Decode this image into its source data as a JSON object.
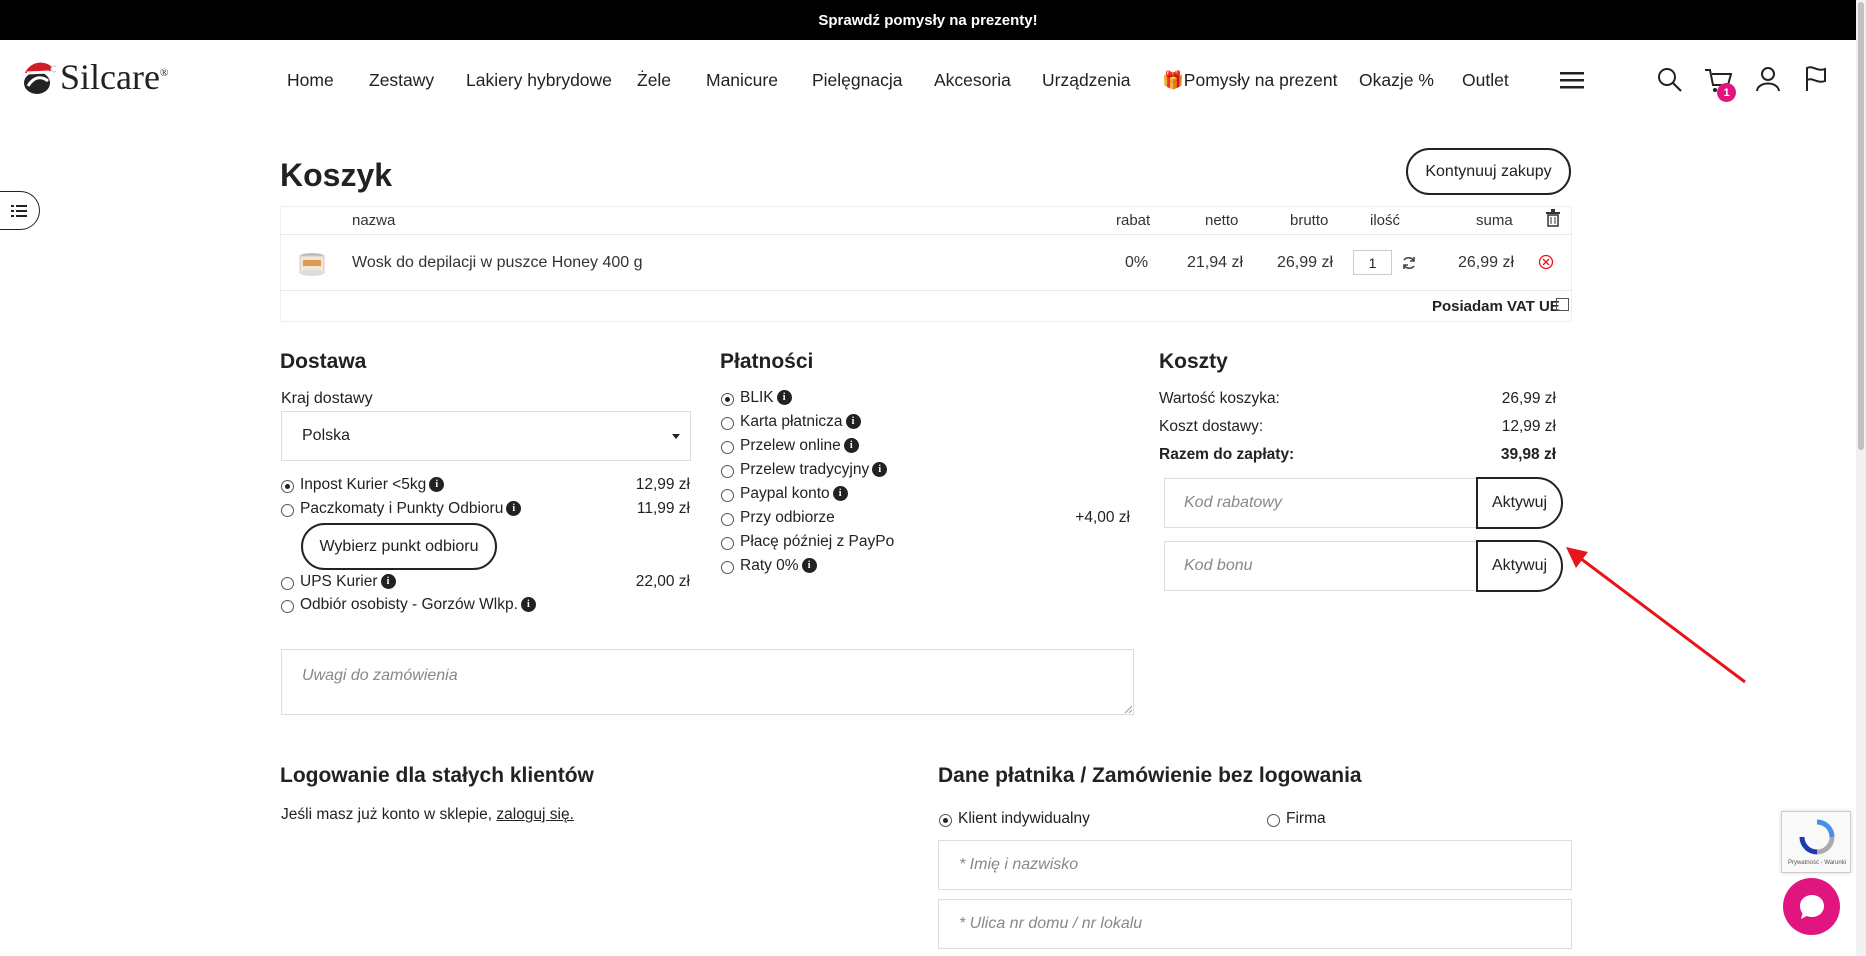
{
  "promo_bar": "Sprawdź pomysły na prezenty!",
  "logo": {
    "text": "Silcare",
    "reg": "®"
  },
  "nav": [
    "Home",
    "Zestawy",
    "Lakiery hybrydowe",
    "Żele",
    "Manicure",
    "Pielęgnacja",
    "Akcesoria",
    "Urządzenia",
    "Pomysły na prezent",
    "Okazje %",
    "Outlet"
  ],
  "cart_count": "1",
  "page_title": "Koszyk",
  "continue_label": "Kontynuuj zakupy",
  "cart": {
    "headers": {
      "name": "nazwa",
      "discount": "rabat",
      "net": "netto",
      "gross": "brutto",
      "qty": "ilość",
      "sum": "suma"
    },
    "items": [
      {
        "name": "Wosk do depilacji w puszce Honey 400 g",
        "discount": "0%",
        "net": "21,94 zł",
        "gross": "26,99 zł",
        "qty": "1",
        "sum": "26,99 zł"
      }
    ],
    "vat_label": "Posiadam VAT UE"
  },
  "delivery": {
    "title": "Dostawa",
    "country_label": "Kraj dostawy",
    "country": "Polska",
    "options": [
      {
        "label": "Inpost Kurier <5kg",
        "price": "12,99 zł",
        "selected": true
      },
      {
        "label": "Paczkomaty i Punkty Odbioru",
        "price": "11,99 zł",
        "selected": false
      },
      {
        "label": "UPS Kurier",
        "price": "22,00 zł",
        "selected": false
      },
      {
        "label": "Odbiór osobisty - Gorzów Wlkp.",
        "price": "",
        "selected": false
      }
    ],
    "pickup_button": "Wybierz punkt odbioru"
  },
  "payments": {
    "title": "Płatności",
    "options": [
      {
        "label": "BLIK",
        "info": true,
        "price": "",
        "selected": true
      },
      {
        "label": "Karta płatnicza",
        "info": true,
        "price": "",
        "selected": false
      },
      {
        "label": "Przelew online",
        "info": true,
        "price": "",
        "selected": false
      },
      {
        "label": "Przelew tradycyjny",
        "info": true,
        "price": "",
        "selected": false
      },
      {
        "label": "Paypal konto",
        "info": true,
        "price": "",
        "selected": false
      },
      {
        "label": "Przy odbiorze",
        "info": false,
        "price": "+4,00 zł",
        "selected": false
      },
      {
        "label": "Płacę później z PayPo",
        "info": false,
        "price": "",
        "selected": false
      },
      {
        "label": "Raty 0%",
        "info": true,
        "price": "",
        "selected": false
      }
    ]
  },
  "costs": {
    "title": "Koszty",
    "cart_value_label": "Wartość koszyka:",
    "cart_value": "26,99 zł",
    "shipping_label": "Koszt dostawy:",
    "shipping": "12,99 zł",
    "total_label": "Razem do zapłaty:",
    "total": "39,98 zł",
    "discount_placeholder": "Kod rabatowy",
    "voucher_placeholder": "Kod bonu",
    "activate_label": "Aktywuj"
  },
  "notes_placeholder": "Uwagi do zamówienia",
  "login": {
    "title": "Logowanie dla stałych klientów",
    "text": "Jeśli masz już konto w sklepie,",
    "link": "zaloguj się."
  },
  "payer": {
    "title": "Dane płatnika / Zamówienie bez logowania",
    "individual": "Klient indywidualny",
    "company": "Firma",
    "name_placeholder": "* Imię i nazwisko",
    "street_placeholder": "* Ulica nr domu / nr lokalu"
  },
  "recaptcha_text": "Prywatność - Warunki",
  "colors": {
    "accent": "#e0157f",
    "arrow": "#e8141b",
    "topbar": "#000000"
  }
}
